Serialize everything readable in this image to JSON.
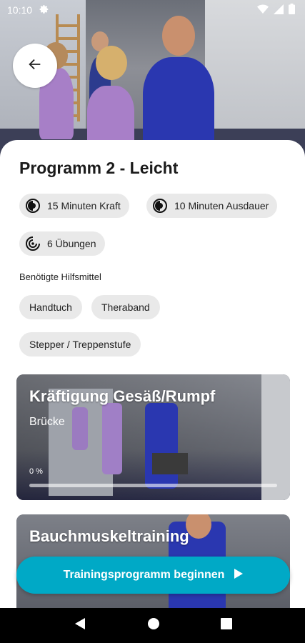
{
  "status_bar": {
    "time": "10:10"
  },
  "program": {
    "title": "Programm 2 - Leicht",
    "chips": [
      {
        "icon": "half-moon-icon",
        "label": "15 Minuten Kraft"
      },
      {
        "icon": "half-moon-icon",
        "label": "10 Minuten Ausdauer"
      },
      {
        "icon": "spiral-icon",
        "label": "6 Übungen"
      }
    ],
    "equipment_label": "Benötigte Hilfsmittel",
    "equipment": [
      "Handtuch",
      "Theraband",
      "Stepper / Treppenstufe"
    ]
  },
  "cards": [
    {
      "title": "Kräftigung Gesäß/Rumpf",
      "subtitle": "Brücke",
      "progress_label": "0 %",
      "progress": 0
    },
    {
      "title": "Bauchmuskeltraining"
    }
  ],
  "cta": {
    "label": "Trainingsprogramm beginnen"
  },
  "colors": {
    "accent": "#00a9c6",
    "chip_bg": "#e9e9e9"
  }
}
